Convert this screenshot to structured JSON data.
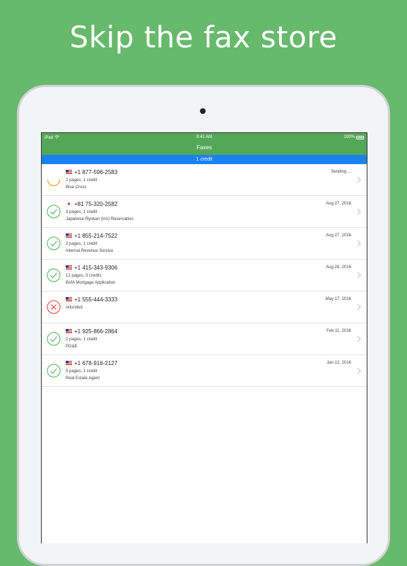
{
  "headline": "Skip the fax store",
  "statusbar": {
    "device": "iPad",
    "time": "9:41 AM",
    "battery": "100%"
  },
  "navbar": {
    "title": "Faxes"
  },
  "creditbar": {
    "text": "1 credit"
  },
  "colors": {
    "background": "#67b96b",
    "nav": "#55a758",
    "credit": "#1a82f2",
    "success": "#4caf50",
    "error": "#e53935",
    "pending": "#f5a623"
  },
  "faxes": [
    {
      "flag": "us-flag",
      "number": "+1 877-596-2583",
      "line2": "2 pages, 1 credit",
      "line3": "Blue Cross",
      "date": "Sending ...",
      "status": "pending"
    },
    {
      "flag": "jp-flag",
      "number": "+81 75-320-2582",
      "line2": "3 pages, 1 credit",
      "line3": "Japanese Ryokan (Inn) Reservation",
      "date": "Aug 27, 2016",
      "status": "success"
    },
    {
      "flag": "us-flag",
      "number": "+1 855-214-7522",
      "line2": "2 pages, 1 credit",
      "line3": "Internal Revenue Service",
      "date": "Aug 27, 2016",
      "status": "success"
    },
    {
      "flag": "us-flag",
      "number": "+1 415-343-9306",
      "line2": "12 pages, 3 credits",
      "line3": "BofA Mortgage Application",
      "date": "Aug 26, 2016",
      "status": "success"
    },
    {
      "flag": "us-flag",
      "number": "+1 555-444-3333",
      "line2": "refunded",
      "line3": "",
      "date": "May 17, 2016",
      "status": "failed"
    },
    {
      "flag": "us-flag",
      "number": "+1 925-866-2864",
      "line2": "2 pages, 1 credit",
      "line3": "PG&E",
      "date": "Feb 11, 2016",
      "status": "success"
    },
    {
      "flag": "us-flag",
      "number": "+1 678-916-2127",
      "line2": "5 pages, 1 credit",
      "line3": "Real Estate Agent",
      "date": "Jan 12, 2016",
      "status": "success"
    }
  ]
}
